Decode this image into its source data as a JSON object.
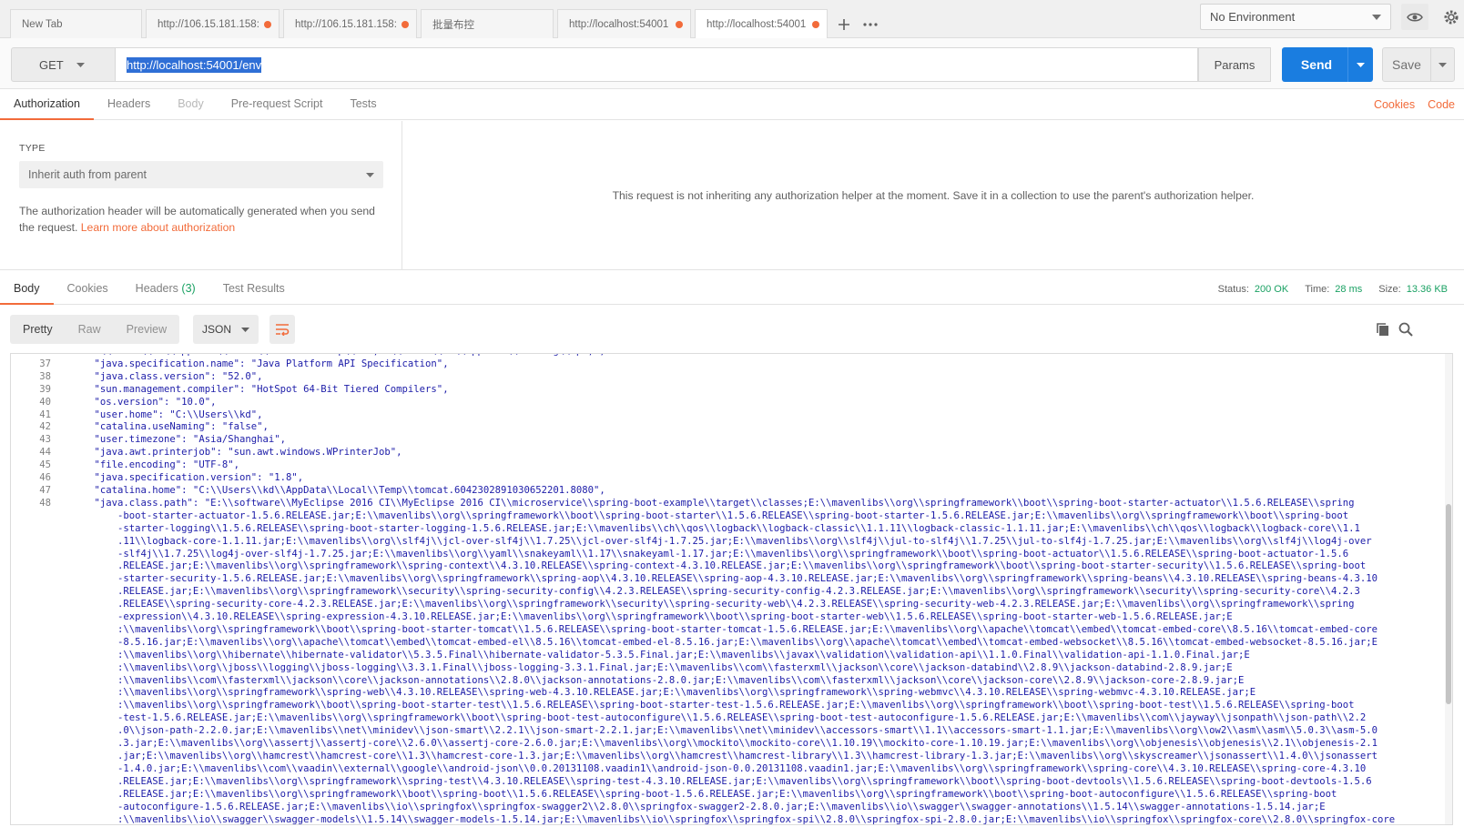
{
  "tabs": [
    {
      "label": "New Tab",
      "dot": false
    },
    {
      "label": "http://106.15.181.158:",
      "dot": true
    },
    {
      "label": "http://106.15.181.158:",
      "dot": true
    },
    {
      "label": "批量布控",
      "dot": false
    },
    {
      "label": "http://localhost:54001",
      "dot": true
    },
    {
      "label": "http://localhost:54001",
      "dot": true
    }
  ],
  "environment": {
    "selected": "No Environment"
  },
  "request": {
    "method": "GET",
    "url": "http://localhost:54001/env",
    "params_label": "Params",
    "send_label": "Send",
    "save_label": "Save"
  },
  "request_tabs": [
    "Authorization",
    "Headers",
    "Body",
    "Pre-request Script",
    "Tests"
  ],
  "request_links": {
    "cookies": "Cookies",
    "code": "Code"
  },
  "auth": {
    "type_label": "TYPE",
    "type_value": "Inherit auth from parent",
    "desc": "The authorization header will be automatically generated when you send the request.",
    "link": "Learn more about authorization",
    "message": "This request is not inheriting any authorization helper at the moment. Save it in a collection to use the parent's authorization helper."
  },
  "response_tabs": {
    "body": "Body",
    "cookies": "Cookies",
    "headers": "Headers",
    "headers_count": "(3)",
    "tests": "Test Results"
  },
  "status": {
    "status_label": "Status:",
    "status_value": "200 OK",
    "time_label": "Time:",
    "time_value": "28 ms",
    "size_label": "Size:",
    "size_value": "13.36 KB"
  },
  "view_modes": [
    "Pretty",
    "Raw",
    "Preview"
  ],
  "format": "JSON",
  "code_lines": [
    {
      "n": "",
      "t": "    :\\\\Users\\\\kd\\\\AppData\\\\Local\\\\GitHubDesktop\\\\bin;C:\\\\Users\\\\kd\\\\AppData\\\\Roaming\\\\npm;\","
    },
    {
      "n": "37",
      "t": "    \"java.specification.name\": \"Java Platform API Specification\","
    },
    {
      "n": "38",
      "t": "    \"java.class.version\": \"52.0\","
    },
    {
      "n": "39",
      "t": "    \"sun.management.compiler\": \"HotSpot 64-Bit Tiered Compilers\","
    },
    {
      "n": "40",
      "t": "    \"os.version\": \"10.0\","
    },
    {
      "n": "41",
      "t": "    \"user.home\": \"C:\\\\Users\\\\kd\","
    },
    {
      "n": "42",
      "t": "    \"catalina.useNaming\": \"false\","
    },
    {
      "n": "43",
      "t": "    \"user.timezone\": \"Asia/Shanghai\","
    },
    {
      "n": "44",
      "t": "    \"java.awt.printerjob\": \"sun.awt.windows.WPrinterJob\","
    },
    {
      "n": "45",
      "t": "    \"file.encoding\": \"UTF-8\","
    },
    {
      "n": "46",
      "t": "    \"java.specification.version\": \"1.8\","
    },
    {
      "n": "47",
      "t": "    \"catalina.home\": \"C:\\\\Users\\\\kd\\\\AppData\\\\Local\\\\Temp\\\\tomcat.6042302891030652201.8080\","
    },
    {
      "n": "48",
      "t": "    \"java.class.path\": \"E:\\\\software\\\\MyEclipse 2016 CI\\\\MyEclipse 2016 CI\\\\microservice\\\\spring-boot-example\\\\target\\\\classes;E:\\\\mavenlibs\\\\org\\\\springframework\\\\boot\\\\spring-boot-starter-actuator\\\\1.5.6.RELEASE\\\\spring"
    },
    {
      "n": "",
      "t": "        -boot-starter-actuator-1.5.6.RELEASE.jar;E:\\\\mavenlibs\\\\org\\\\springframework\\\\boot\\\\spring-boot-starter\\\\1.5.6.RELEASE\\\\spring-boot-starter-1.5.6.RELEASE.jar;E:\\\\mavenlibs\\\\org\\\\springframework\\\\boot\\\\spring-boot"
    },
    {
      "n": "",
      "t": "        -starter-logging\\\\1.5.6.RELEASE\\\\spring-boot-starter-logging-1.5.6.RELEASE.jar;E:\\\\mavenlibs\\\\ch\\\\qos\\\\logback\\\\logback-classic\\\\1.1.11\\\\logback-classic-1.1.11.jar;E:\\\\mavenlibs\\\\ch\\\\qos\\\\logback\\\\logback-core\\\\1.1"
    },
    {
      "n": "",
      "t": "        .11\\\\logback-core-1.1.11.jar;E:\\\\mavenlibs\\\\org\\\\slf4j\\\\jcl-over-slf4j\\\\1.7.25\\\\jcl-over-slf4j-1.7.25.jar;E:\\\\mavenlibs\\\\org\\\\slf4j\\\\jul-to-slf4j\\\\1.7.25\\\\jul-to-slf4j-1.7.25.jar;E:\\\\mavenlibs\\\\org\\\\slf4j\\\\log4j-over"
    },
    {
      "n": "",
      "t": "        -slf4j\\\\1.7.25\\\\log4j-over-slf4j-1.7.25.jar;E:\\\\mavenlibs\\\\org\\\\yaml\\\\snakeyaml\\\\1.17\\\\snakeyaml-1.17.jar;E:\\\\mavenlibs\\\\org\\\\springframework\\\\boot\\\\spring-boot-actuator\\\\1.5.6.RELEASE\\\\spring-boot-actuator-1.5.6"
    },
    {
      "n": "",
      "t": "        .RELEASE.jar;E:\\\\mavenlibs\\\\org\\\\springframework\\\\spring-context\\\\4.3.10.RELEASE\\\\spring-context-4.3.10.RELEASE.jar;E:\\\\mavenlibs\\\\org\\\\springframework\\\\boot\\\\spring-boot-starter-security\\\\1.5.6.RELEASE\\\\spring-boot"
    },
    {
      "n": "",
      "t": "        -starter-security-1.5.6.RELEASE.jar;E:\\\\mavenlibs\\\\org\\\\springframework\\\\spring-aop\\\\4.3.10.RELEASE\\\\spring-aop-4.3.10.RELEASE.jar;E:\\\\mavenlibs\\\\org\\\\springframework\\\\spring-beans\\\\4.3.10.RELEASE\\\\spring-beans-4.3.10"
    },
    {
      "n": "",
      "t": "        .RELEASE.jar;E:\\\\mavenlibs\\\\org\\\\springframework\\\\security\\\\spring-security-config\\\\4.2.3.RELEASE\\\\spring-security-config-4.2.3.RELEASE.jar;E:\\\\mavenlibs\\\\org\\\\springframework\\\\security\\\\spring-security-core\\\\4.2.3"
    },
    {
      "n": "",
      "t": "        .RELEASE\\\\spring-security-core-4.2.3.RELEASE.jar;E:\\\\mavenlibs\\\\org\\\\springframework\\\\security\\\\spring-security-web\\\\4.2.3.RELEASE\\\\spring-security-web-4.2.3.RELEASE.jar;E:\\\\mavenlibs\\\\org\\\\springframework\\\\spring"
    },
    {
      "n": "",
      "t": "        -expression\\\\4.3.10.RELEASE\\\\spring-expression-4.3.10.RELEASE.jar;E:\\\\mavenlibs\\\\org\\\\springframework\\\\boot\\\\spring-boot-starter-web\\\\1.5.6.RELEASE\\\\spring-boot-starter-web-1.5.6.RELEASE.jar;E"
    },
    {
      "n": "",
      "t": "        :\\\\mavenlibs\\\\org\\\\springframework\\\\boot\\\\spring-boot-starter-tomcat\\\\1.5.6.RELEASE\\\\spring-boot-starter-tomcat-1.5.6.RELEASE.jar;E:\\\\mavenlibs\\\\org\\\\apache\\\\tomcat\\\\embed\\\\tomcat-embed-core\\\\8.5.16\\\\tomcat-embed-core"
    },
    {
      "n": "",
      "t": "        -8.5.16.jar;E:\\\\mavenlibs\\\\org\\\\apache\\\\tomcat\\\\embed\\\\tomcat-embed-el\\\\8.5.16\\\\tomcat-embed-el-8.5.16.jar;E:\\\\mavenlibs\\\\org\\\\apache\\\\tomcat\\\\embed\\\\tomcat-embed-websocket\\\\8.5.16\\\\tomcat-embed-websocket-8.5.16.jar;E"
    },
    {
      "n": "",
      "t": "        :\\\\mavenlibs\\\\org\\\\hibernate\\\\hibernate-validator\\\\5.3.5.Final\\\\hibernate-validator-5.3.5.Final.jar;E:\\\\mavenlibs\\\\javax\\\\validation\\\\validation-api\\\\1.1.0.Final\\\\validation-api-1.1.0.Final.jar;E"
    },
    {
      "n": "",
      "t": "        :\\\\mavenlibs\\\\org\\\\jboss\\\\logging\\\\jboss-logging\\\\3.3.1.Final\\\\jboss-logging-3.3.1.Final.jar;E:\\\\mavenlibs\\\\com\\\\fasterxml\\\\jackson\\\\core\\\\jackson-databind\\\\2.8.9\\\\jackson-databind-2.8.9.jar;E"
    },
    {
      "n": "",
      "t": "        :\\\\mavenlibs\\\\com\\\\fasterxml\\\\jackson\\\\core\\\\jackson-annotations\\\\2.8.0\\\\jackson-annotations-2.8.0.jar;E:\\\\mavenlibs\\\\com\\\\fasterxml\\\\jackson\\\\core\\\\jackson-core\\\\2.8.9\\\\jackson-core-2.8.9.jar;E"
    },
    {
      "n": "",
      "t": "        :\\\\mavenlibs\\\\org\\\\springframework\\\\spring-web\\\\4.3.10.RELEASE\\\\spring-web-4.3.10.RELEASE.jar;E:\\\\mavenlibs\\\\org\\\\springframework\\\\spring-webmvc\\\\4.3.10.RELEASE\\\\spring-webmvc-4.3.10.RELEASE.jar;E"
    },
    {
      "n": "",
      "t": "        :\\\\mavenlibs\\\\org\\\\springframework\\\\boot\\\\spring-boot-starter-test\\\\1.5.6.RELEASE\\\\spring-boot-starter-test-1.5.6.RELEASE.jar;E:\\\\mavenlibs\\\\org\\\\springframework\\\\boot\\\\spring-boot-test\\\\1.5.6.RELEASE\\\\spring-boot"
    },
    {
      "n": "",
      "t": "        -test-1.5.6.RELEASE.jar;E:\\\\mavenlibs\\\\org\\\\springframework\\\\boot\\\\spring-boot-test-autoconfigure\\\\1.5.6.RELEASE\\\\spring-boot-test-autoconfigure-1.5.6.RELEASE.jar;E:\\\\mavenlibs\\\\com\\\\jayway\\\\jsonpath\\\\json-path\\\\2.2"
    },
    {
      "n": "",
      "t": "        .0\\\\json-path-2.2.0.jar;E:\\\\mavenlibs\\\\net\\\\minidev\\\\json-smart\\\\2.2.1\\\\json-smart-2.2.1.jar;E:\\\\mavenlibs\\\\net\\\\minidev\\\\accessors-smart\\\\1.1\\\\accessors-smart-1.1.jar;E:\\\\mavenlibs\\\\org\\\\ow2\\\\asm\\\\asm\\\\5.0.3\\\\asm-5.0"
    },
    {
      "n": "",
      "t": "        .3.jar;E:\\\\mavenlibs\\\\org\\\\assertj\\\\assertj-core\\\\2.6.0\\\\assertj-core-2.6.0.jar;E:\\\\mavenlibs\\\\org\\\\mockito\\\\mockito-core\\\\1.10.19\\\\mockito-core-1.10.19.jar;E:\\\\mavenlibs\\\\org\\\\objenesis\\\\objenesis\\\\2.1\\\\objenesis-2.1"
    },
    {
      "n": "",
      "t": "        .jar;E:\\\\mavenlibs\\\\org\\\\hamcrest\\\\hamcrest-core\\\\1.3\\\\hamcrest-core-1.3.jar;E:\\\\mavenlibs\\\\org\\\\hamcrest\\\\hamcrest-library\\\\1.3\\\\hamcrest-library-1.3.jar;E:\\\\mavenlibs\\\\org\\\\skyscreamer\\\\jsonassert\\\\1.4.0\\\\jsonassert"
    },
    {
      "n": "",
      "t": "        -1.4.0.jar;E:\\\\mavenlibs\\\\com\\\\vaadin\\\\external\\\\google\\\\android-json\\\\0.0.20131108.vaadin1\\\\android-json-0.0.20131108.vaadin1.jar;E:\\\\mavenlibs\\\\org\\\\springframework\\\\spring-core\\\\4.3.10.RELEASE\\\\spring-core-4.3.10"
    },
    {
      "n": "",
      "t": "        .RELEASE.jar;E:\\\\mavenlibs\\\\org\\\\springframework\\\\spring-test\\\\4.3.10.RELEASE\\\\spring-test-4.3.10.RELEASE.jar;E:\\\\mavenlibs\\\\org\\\\springframework\\\\boot\\\\spring-boot-devtools\\\\1.5.6.RELEASE\\\\spring-boot-devtools-1.5.6"
    },
    {
      "n": "",
      "t": "        .RELEASE.jar;E:\\\\mavenlibs\\\\org\\\\springframework\\\\boot\\\\spring-boot\\\\1.5.6.RELEASE\\\\spring-boot-1.5.6.RELEASE.jar;E:\\\\mavenlibs\\\\org\\\\springframework\\\\boot\\\\spring-boot-autoconfigure\\\\1.5.6.RELEASE\\\\spring-boot"
    },
    {
      "n": "",
      "t": "        -autoconfigure-1.5.6.RELEASE.jar;E:\\\\mavenlibs\\\\io\\\\springfox\\\\springfox-swagger2\\\\2.8.0\\\\springfox-swagger2-2.8.0.jar;E:\\\\mavenlibs\\\\io\\\\swagger\\\\swagger-annotations\\\\1.5.14\\\\swagger-annotations-1.5.14.jar;E"
    },
    {
      "n": "",
      "t": "        :\\\\mavenlibs\\\\io\\\\swagger\\\\swagger-models\\\\1.5.14\\\\swagger-models-1.5.14.jar;E:\\\\mavenlibs\\\\io\\\\springfox\\\\springfox-spi\\\\2.8.0\\\\springfox-spi-2.8.0.jar;E:\\\\mavenlibs\\\\io\\\\springfox\\\\springfox-core\\\\2.8.0\\\\springfox-core"
    }
  ]
}
